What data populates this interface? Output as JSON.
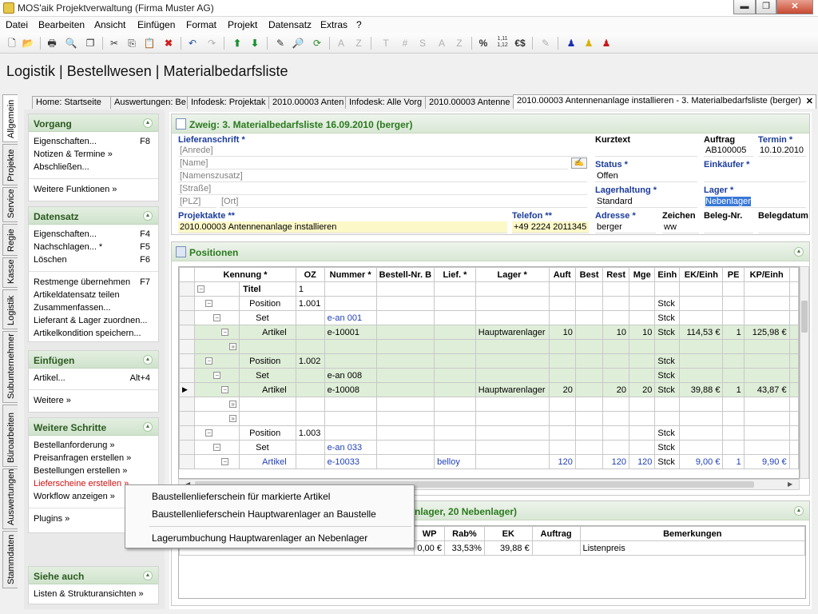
{
  "window": {
    "title": "MOS'aik Projektverwaltung (Firma Muster AG)",
    "btn_min": "▬",
    "btn_max": "❐",
    "btn_close": "✕"
  },
  "menu": [
    "Datei",
    "Bearbeiten",
    "Ansicht",
    "Einfügen",
    "Format",
    "Projekt",
    "Datensatz",
    "Extras",
    "?"
  ],
  "toolbar": {
    "letters": [
      "A",
      "Z",
      "T",
      "#",
      "S",
      "A",
      "Z"
    ],
    "percent": "%",
    "decimals": "1,11\n1,12",
    "euro": "€$"
  },
  "page_title": "Logistik | Bestellwesen | Materialbedarfsliste",
  "vtabs": [
    "Allgemein",
    "Projekte",
    "Service",
    "Regie",
    "Kasse",
    "Logistik",
    "Subunternehmer",
    "Büroarbeiten",
    "Auswertungen",
    "Stammdaten"
  ],
  "doc_tabs": [
    "Home: Startseite",
    "Auswertungen: Be",
    "Infodesk: Projektak",
    "2010.00003 Anten",
    "Infodesk: Alle Vorg",
    "2010.00003 Antenne",
    "2010.00003 Antennenanlage installieren - 3. Materialbedarfsliste (berger)"
  ],
  "doc_tab_close": "✕",
  "left": {
    "vorgang": {
      "title": "Vorgang",
      "items": [
        {
          "label": "Eigenschaften...",
          "key": "F8"
        },
        {
          "label": "Notizen & Termine »",
          "key": ""
        },
        {
          "label": "Abschließen...",
          "key": ""
        },
        {
          "label": "Weitere Funktionen »",
          "key": ""
        }
      ]
    },
    "datensatz": {
      "title": "Datensatz",
      "items": [
        {
          "label": "Eigenschaften...",
          "key": "F4"
        },
        {
          "label": "Nachschlagen... *",
          "key": "F5"
        },
        {
          "label": "Löschen",
          "key": "F6"
        },
        {
          "label": "Restmenge übernehmen",
          "key": "F7"
        },
        {
          "label": "Artikeldatensatz teilen",
          "key": ""
        },
        {
          "label": "Zusammenfassen...",
          "key": ""
        },
        {
          "label": "Lieferant & Lager zuordnen...",
          "key": ""
        },
        {
          "label": "Artikelkondition speichern...",
          "key": ""
        }
      ]
    },
    "einfuegen": {
      "title": "Einfügen",
      "items": [
        {
          "label": "Artikel...",
          "key": "Alt+4"
        },
        {
          "label": "Weitere »",
          "key": ""
        }
      ]
    },
    "weitere": {
      "title": "Weitere Schritte",
      "items": [
        {
          "label": "Bestellanforderung »"
        },
        {
          "label": "Preisanfragen erstellen »"
        },
        {
          "label": "Bestellungen erstellen »"
        },
        {
          "label": "Lieferscheine erstellen »"
        },
        {
          "label": "Workflow anzeigen »"
        },
        {
          "label": "Plugins »"
        }
      ]
    },
    "sieheauch": {
      "title": "Siehe auch",
      "items": [
        {
          "label": "Listen & Strukturansichten »"
        }
      ]
    }
  },
  "header": {
    "title": "Zweig: 3. Materialbedarfsliste 16.09.2010 (berger)",
    "lieferanschrift_label": "Lieferanschrift *",
    "anrede": "[Anrede]",
    "name": "[Name]",
    "namenszusatz": "[Namenszusatz]",
    "strasse": "[Straße]",
    "plz": "[PLZ]",
    "ort": "[Ort]",
    "kurztext_label": "Kurztext",
    "kurztext": "",
    "auftrag_label": "Auftrag",
    "auftrag": "AB100005",
    "termin_label": "Termin *",
    "termin": "10.10.2010",
    "status_label": "Status *",
    "status": "Offen",
    "einkaeufer_label": "Einkäufer *",
    "einkaeufer": "",
    "lagerhaltung_label": "Lagerhaltung *",
    "lagerhaltung": "Standard",
    "lager_label": "Lager *",
    "lager": "Nebenlager",
    "projektakte_label": "Projektakte **",
    "projektakte": "2010.00003 Antennenanlage installieren",
    "telefon_label": "Telefon **",
    "telefon": "+49 2224 2011345",
    "adresse_label": "Adresse *",
    "adresse": "berger",
    "zeichen_label": "Zeichen",
    "zeichen": "ww",
    "belegnr_label": "Beleg-Nr.",
    "belegnr": "",
    "belegdatum_label": "Belegdatum",
    "belegdatum": ""
  },
  "positions": {
    "title": "Positionen",
    "columns": [
      "Kennung *",
      "OZ",
      "Nummer *",
      "Bestell-Nr. B",
      "Lief. *",
      "Lager *",
      "Auft",
      "Best",
      "Rest",
      "Mge",
      "Einh",
      "EK/Einh",
      "PE",
      "KP/Einh"
    ],
    "rows": [
      {
        "kennung": "Titel",
        "oz": "1",
        "nummer": "",
        "lager": "",
        "auft": "",
        "best": "",
        "rest": "",
        "mge": "",
        "einh": "",
        "ek": "",
        "pe": "",
        "kp": "",
        "level": 0,
        "green": false,
        "bold": true
      },
      {
        "kennung": "Position",
        "oz": "1.001",
        "nummer": "",
        "lager": "",
        "auft": "",
        "best": "",
        "rest": "",
        "mge": "",
        "einh": "Stck",
        "ek": "",
        "pe": "",
        "kp": "",
        "level": 1,
        "green": false
      },
      {
        "kennung": "Set",
        "oz": "",
        "nummer": "e-an 001",
        "lager": "",
        "auft": "",
        "best": "",
        "rest": "",
        "mge": "",
        "einh": "Stck",
        "ek": "",
        "pe": "",
        "kp": "",
        "level": 2,
        "green": false,
        "blue": true
      },
      {
        "kennung": "Artikel",
        "oz": "",
        "nummer": "e-10001",
        "lager": "Hauptwarenlager",
        "auft": "10",
        "best": "",
        "rest": "10",
        "mge": "10",
        "einh": "Stck",
        "ek": "114,53 €",
        "pe": "1",
        "kp": "125,98 €",
        "level": 3,
        "green": true
      },
      {
        "kennung": "",
        "oz": "",
        "nummer": "",
        "lager": "",
        "auft": "",
        "best": "",
        "rest": "",
        "mge": "",
        "einh": "",
        "ek": "",
        "pe": "",
        "kp": "",
        "level": 4,
        "green": true,
        "sub": true
      },
      {
        "kennung": "Position",
        "oz": "1.002",
        "nummer": "",
        "lager": "",
        "auft": "",
        "best": "",
        "rest": "",
        "mge": "",
        "einh": "Stck",
        "ek": "",
        "pe": "",
        "kp": "",
        "level": 1,
        "green": true
      },
      {
        "kennung": "Set",
        "oz": "",
        "nummer": "e-an 008",
        "lager": "",
        "auft": "",
        "best": "",
        "rest": "",
        "mge": "",
        "einh": "Stck",
        "ek": "",
        "pe": "",
        "kp": "",
        "level": 2,
        "green": true
      },
      {
        "kennung": "Artikel",
        "oz": "",
        "nummer": "e-10008",
        "lager": "Hauptwarenlager",
        "auft": "20",
        "best": "",
        "rest": "20",
        "mge": "20",
        "einh": "Stck",
        "ek": "39,88 €",
        "pe": "1",
        "kp": "43,87 €",
        "level": 3,
        "green": true,
        "current": true
      },
      {
        "kennung": "",
        "oz": "",
        "nummer": "",
        "lager": "",
        "auft": "",
        "best": "",
        "rest": "",
        "mge": "",
        "einh": "",
        "ek": "",
        "pe": "",
        "kp": "",
        "level": 4,
        "green": false,
        "sub": true
      },
      {
        "kennung": "",
        "oz": "",
        "nummer": "",
        "lager": "",
        "auft": "",
        "best": "",
        "rest": "",
        "mge": "",
        "einh": "",
        "ek": "",
        "pe": "",
        "kp": "",
        "level": 4,
        "green": false,
        "sub": true
      },
      {
        "kennung": "Position",
        "oz": "1.003",
        "nummer": "",
        "lager": "",
        "auft": "",
        "best": "",
        "rest": "",
        "mge": "",
        "einh": "Stck",
        "ek": "",
        "pe": "",
        "kp": "",
        "level": 1,
        "green": false
      },
      {
        "kennung": "Set",
        "oz": "",
        "nummer": "e-an 033",
        "lager": "",
        "auft": "",
        "best": "",
        "rest": "",
        "mge": "",
        "einh": "Stck",
        "ek": "",
        "pe": "",
        "kp": "",
        "level": 2,
        "green": false,
        "blue": true
      },
      {
        "kennung": "Artikel",
        "oz": "",
        "nummer": "e-10033",
        "lief": "belloy",
        "lager": "",
        "auft": "120",
        "best": "",
        "rest": "120",
        "mge": "120",
        "einh": "Stck",
        "ek": "9,00 €",
        "pe": "1",
        "kp": "9,90 €",
        "level": 3,
        "green": false,
        "blue": true
      }
    ]
  },
  "bottom": {
    "title_suffix": "nlager, 20 Nebenlager)",
    "columns": [
      "WP",
      "Rab%",
      "EK",
      "Auftrag",
      "Bemerkungen"
    ],
    "row": {
      "wp": "0,00 €",
      "rab": "33,53%",
      "ek": "39,88 €",
      "auftrag": "",
      "bemerkungen": "Listenpreis"
    }
  },
  "context_menu": [
    "Baustellenlieferschein für markierte Artikel",
    "Baustellenlieferschein Hauptwarenlager an Baustelle",
    "Lagerumbuchung Hauptwarenlager an Nebenlager"
  ]
}
